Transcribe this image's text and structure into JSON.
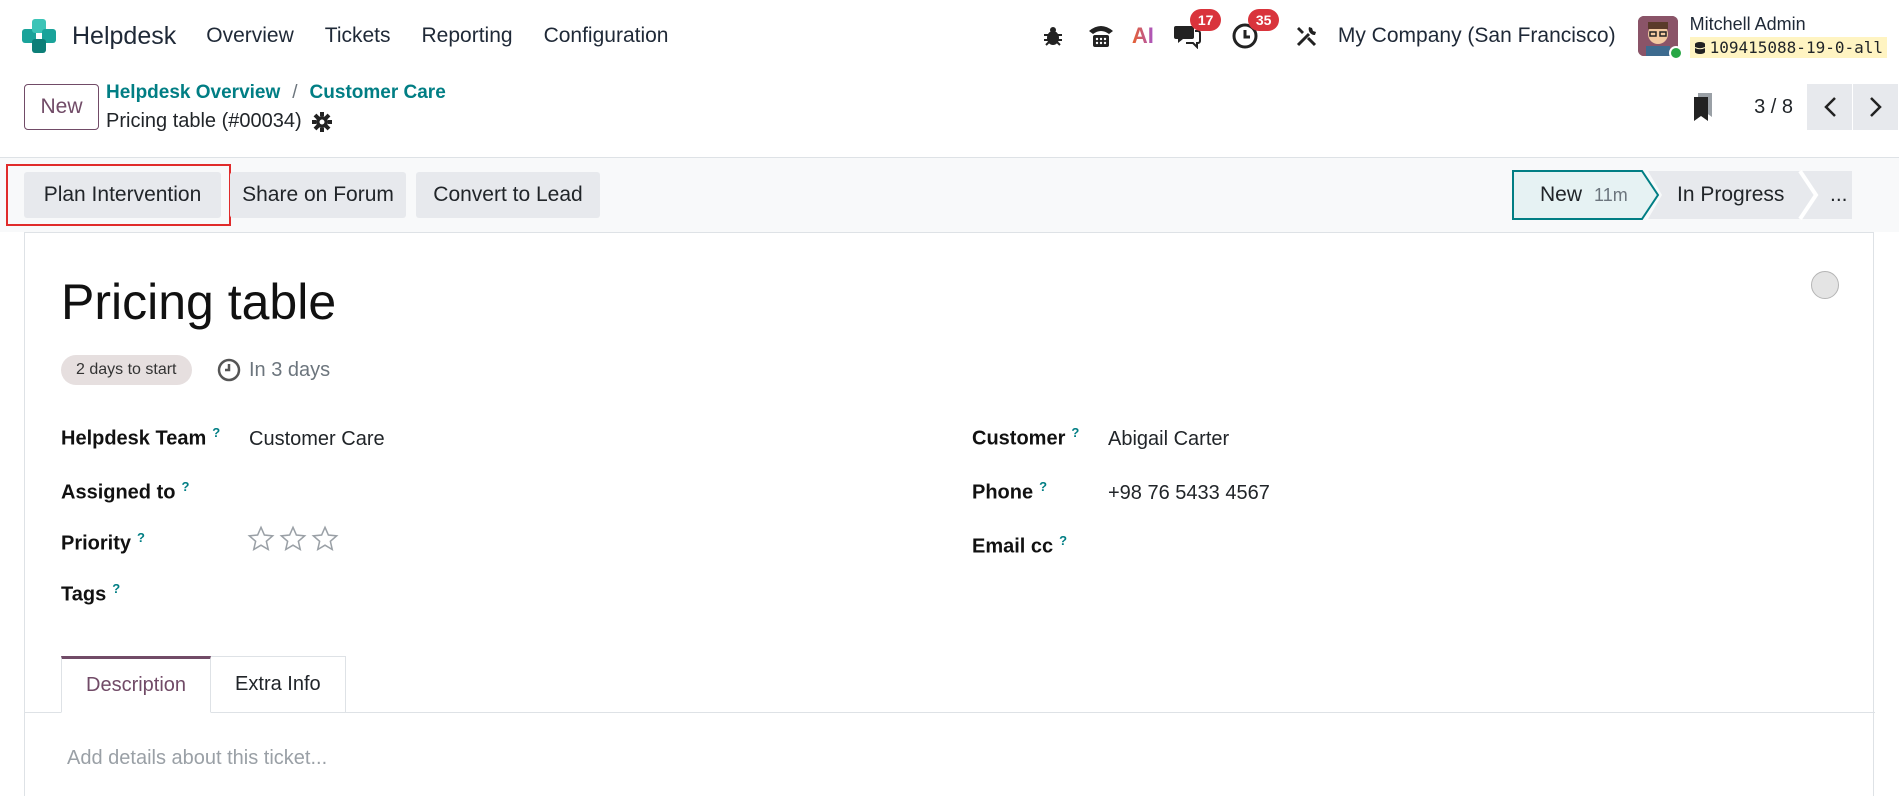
{
  "app": {
    "name": "Helpdesk",
    "menu": [
      "Overview",
      "Tickets",
      "Reporting",
      "Configuration"
    ]
  },
  "systray": {
    "messages_count": "17",
    "activities_count": "35",
    "ai_label": "AI",
    "company": "My Company (San Francisco)",
    "user_name": "Mitchell Admin",
    "database": "109415088-19-0-all"
  },
  "control_panel": {
    "new_label": "New",
    "breadcrumbs": [
      "Helpdesk Overview",
      "Customer Care"
    ],
    "breadcrumb_sep": "/",
    "record_name": "Pricing table (#00034)",
    "pager": "3 / 8"
  },
  "statusbar": {
    "actions": [
      "Plan Intervention",
      "Share on Forum",
      "Convert to Lead"
    ],
    "stages": [
      {
        "label": "New",
        "duration": "11m",
        "active": true
      },
      {
        "label": "In Progress"
      },
      {
        "label": "..."
      }
    ]
  },
  "form": {
    "title": "Pricing table",
    "sla_pill": "2 days to start",
    "deadline": "In 3 days",
    "help_mark": "?",
    "left_fields": [
      {
        "label": "Helpdesk Team",
        "value": "Customer Care"
      },
      {
        "label": "Assigned to",
        "value": ""
      },
      {
        "label": "Priority",
        "value": ""
      },
      {
        "label": "Tags",
        "value": ""
      }
    ],
    "right_fields": [
      {
        "label": "Customer",
        "value": "Abigail Carter"
      },
      {
        "label": "Phone",
        "value": "+98 76 5433 4567"
      },
      {
        "label": "Email cc",
        "value": ""
      }
    ],
    "priority_stars": 0,
    "priority_max": 3,
    "tabs": [
      "Description",
      "Extra Info"
    ],
    "description_placeholder": "Add details about this ticket..."
  },
  "colors": {
    "brand_purple": "#714b67",
    "link_teal": "#017e84",
    "badge_red": "#d9343c",
    "highlight_red": "#e02b2b"
  }
}
